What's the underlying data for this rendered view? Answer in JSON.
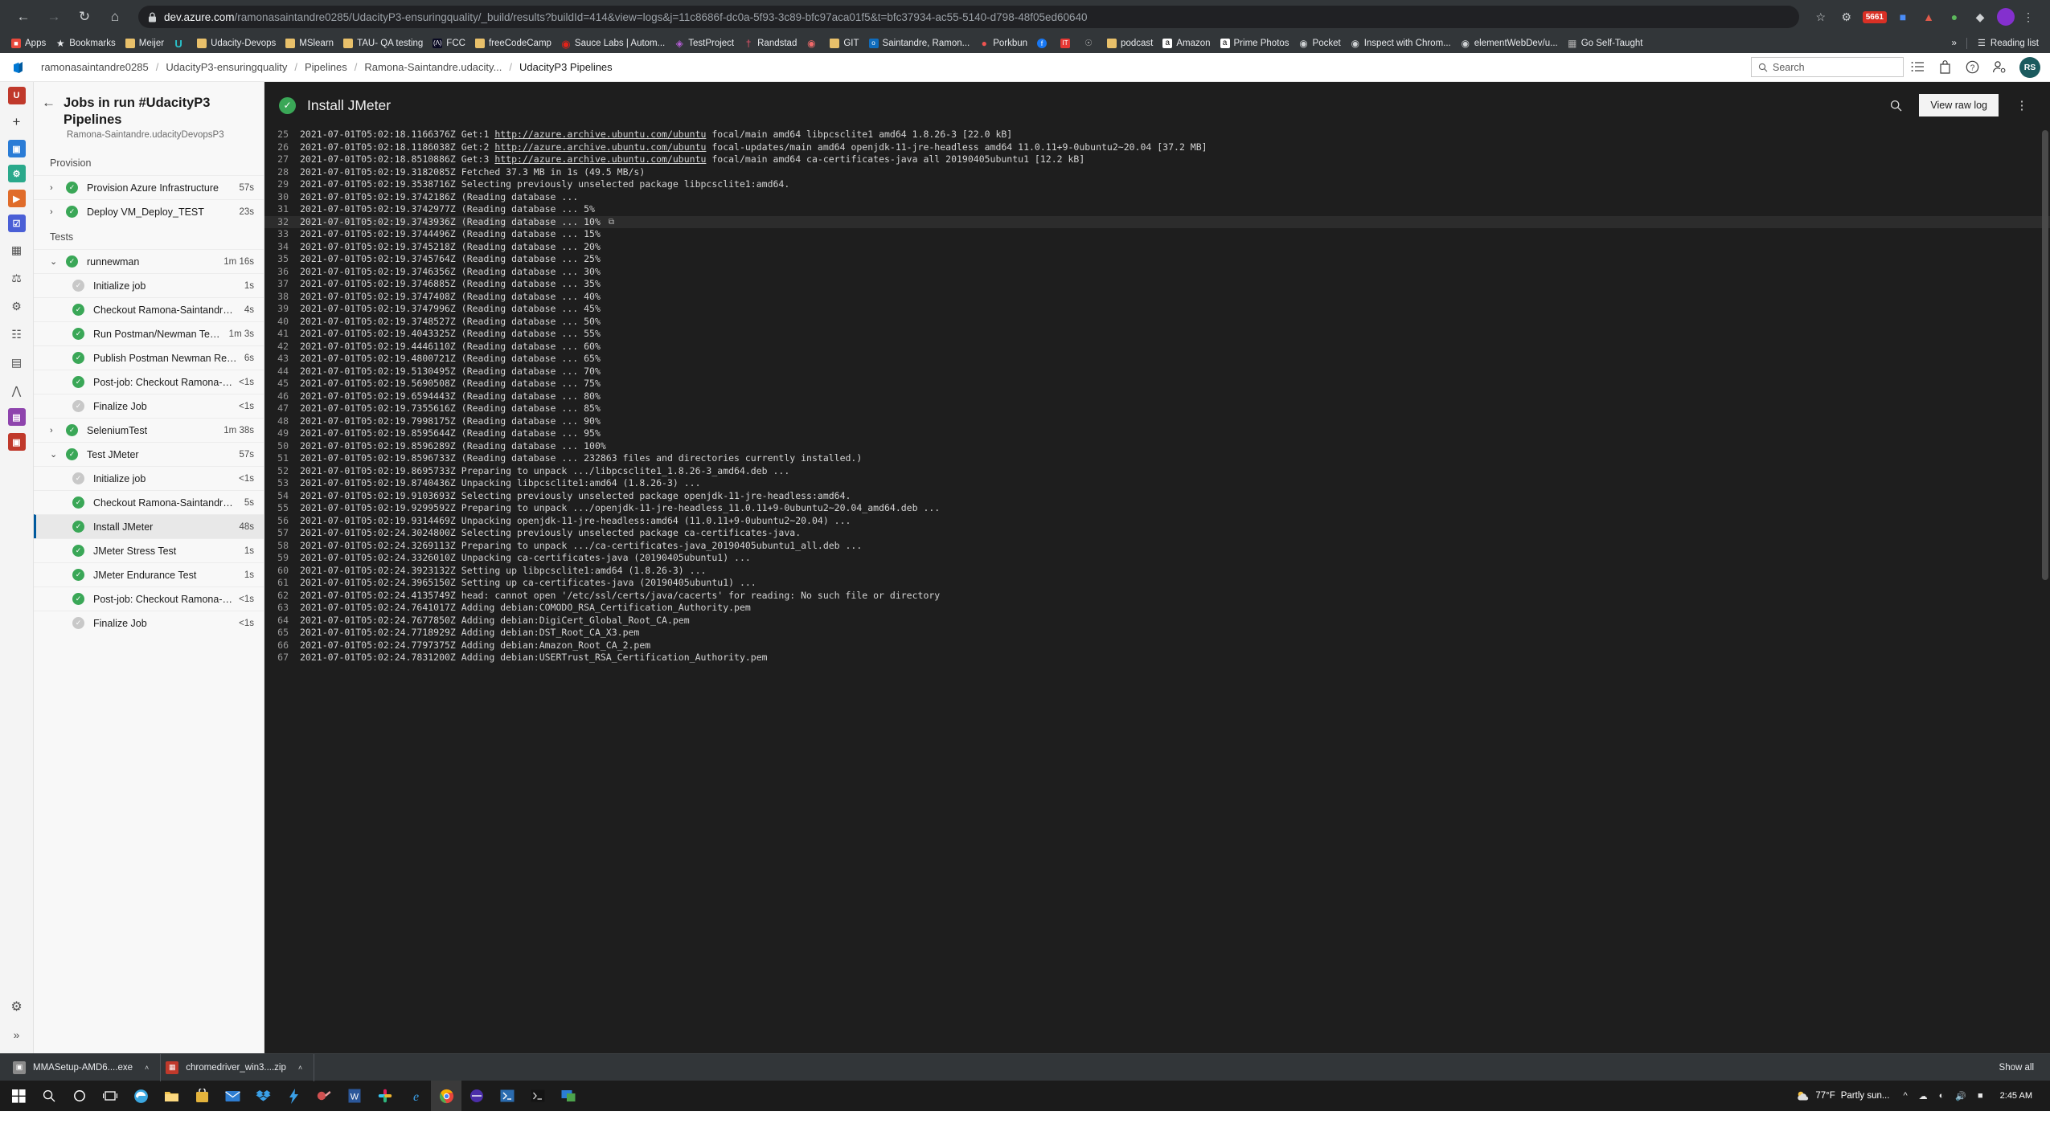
{
  "browser": {
    "url_host": "dev.azure.com",
    "url_path": "/ramonasaintandre0285/UdacityP3-ensuringquality/_build/results?buildId=414&view=logs&j=11c8686f-dc0a-5f93-3c89-bfc97aca01f5&t=bfc37934-ac55-5140-d798-48f05ed60640",
    "back_icon": "back-arrow",
    "forward_icon": "forward-arrow",
    "reload_icon": "reload",
    "home_icon": "home",
    "lock_icon": "lock",
    "extension_badge": "5661",
    "profile_initial": "",
    "bookmarks": [
      {
        "label": "Apps",
        "icon": "apps-grid",
        "color": "#4a8cf7"
      },
      {
        "label": "Bookmarks",
        "icon": "star",
        "color": "#dcdcdc"
      },
      {
        "label": "Meijer",
        "icon": "folder",
        "color": "#e8c06a"
      },
      {
        "label": "",
        "icon": "udemy-u",
        "color": "#29c3cc"
      },
      {
        "label": "Udacity-Devops",
        "icon": "folder",
        "color": "#e8c06a"
      },
      {
        "label": "MSlearn",
        "icon": "folder",
        "color": "#e8c06a"
      },
      {
        "label": "TAU- QA testing",
        "icon": "folder",
        "color": "#e8c06a"
      },
      {
        "label": "FCC",
        "icon": "fcc-badge",
        "color": "#0a0a23"
      },
      {
        "label": "freeCodeCamp",
        "icon": "folder",
        "color": "#e8c06a"
      },
      {
        "label": "Sauce Labs | Autom...",
        "icon": "sauce-labs",
        "color": "#e2231a"
      },
      {
        "label": "TestProject",
        "icon": "testproject",
        "color": "#b45dd6"
      },
      {
        "label": "Randstad",
        "icon": "randstad",
        "color": "#e8546b"
      },
      {
        "label": "",
        "icon": "asana-dots",
        "color": "#f06a6a"
      },
      {
        "label": "GIT",
        "icon": "folder",
        "color": "#e8c06a"
      },
      {
        "label": "Saintandre, Ramon...",
        "icon": "outlook",
        "color": "#0f6cbd"
      },
      {
        "label": "Porkbun",
        "icon": "porkbun",
        "color": "#ef5350"
      },
      {
        "label": "",
        "icon": "facebook",
        "color": "#1877f2"
      },
      {
        "label": "",
        "icon": "it-ticket",
        "color": "#e53935"
      },
      {
        "label": "",
        "icon": "cb-coin",
        "color": "#b0b0b0"
      },
      {
        "label": "podcast",
        "icon": "folder",
        "color": "#e8c06a"
      },
      {
        "label": "Amazon",
        "icon": "amazon",
        "color": "#ffffff"
      },
      {
        "label": "Prime Photos",
        "icon": "amazon",
        "color": "#ffffff"
      },
      {
        "label": "Pocket",
        "icon": "pocket",
        "color": "#ef4056"
      },
      {
        "label": "Inspect with Chrom...",
        "icon": "pocket",
        "color": "#9aa0a6"
      },
      {
        "label": "elementWebDev/u...",
        "icon": "pocket",
        "color": "#9aa0a6"
      },
      {
        "label": "Go Self-Taught",
        "icon": "cube",
        "color": "#b0b0b0"
      }
    ],
    "overflow_label": "»",
    "reading_list_label": "Reading list",
    "reading_list_icon": "reading-list-icon"
  },
  "ado_header": {
    "logo_icon": "azure-devops-logo",
    "breadcrumb": [
      "ramonasaintandre0285",
      "UdacityP3-ensuringquality",
      "Pipelines",
      "Ramona-Saintandre.udacity...",
      "UdacityP3 Pipelines"
    ],
    "search_placeholder": "Search",
    "search_icon": "search-icon",
    "icons": [
      {
        "name": "boards-list-icon"
      },
      {
        "name": "marketplace-bag-icon"
      },
      {
        "name": "help-question-icon"
      },
      {
        "name": "user-settings-icon"
      }
    ],
    "avatar_initials": "RS",
    "avatar_color": "#1b5a5e"
  },
  "rail": {
    "items": [
      {
        "name": "overview-badge",
        "glyph": "U",
        "color": "#c0392b"
      },
      {
        "name": "new-item-icon",
        "glyph": "＋",
        "color": ""
      },
      {
        "name": "boards-icon",
        "glyph": "",
        "color": "#2a7cd6"
      },
      {
        "name": "repos-icon",
        "glyph": "",
        "color": "#2aa98b"
      },
      {
        "name": "pipelines-icon",
        "glyph": "",
        "color": "#e06c2a"
      },
      {
        "name": "test-plans-icon",
        "glyph": "",
        "color": "#4a5fd6"
      },
      {
        "name": "artifacts-icon",
        "glyph": "",
        "color": "#3b3b3b"
      },
      {
        "name": "environments-icon",
        "glyph": "",
        "color": "#3b3b3b"
      },
      {
        "name": "releases-icon",
        "glyph": "",
        "color": "#3b3b3b"
      },
      {
        "name": "library-icon",
        "glyph": "",
        "color": "#3b3b3b"
      },
      {
        "name": "task-groups-icon",
        "glyph": "",
        "color": "#3b3b3b"
      },
      {
        "name": "deployment-groups-icon",
        "glyph": "",
        "color": "#3b3b3b"
      },
      {
        "name": "analytics-icon",
        "glyph": "",
        "color": "#8e44ad"
      },
      {
        "name": "extensions-icon",
        "glyph": "",
        "color": "#c0392b"
      }
    ],
    "settings_icon": "settings-gear-icon",
    "expand_icon": "expand-chevrons-icon"
  },
  "jobs_panel": {
    "back_icon": "back-arrow-icon",
    "title": "Jobs in run #UdacityP3 Pipelines",
    "subtitle": "Ramona-Saintandre.udacityDevopsP3",
    "groups": [
      {
        "label": "Provision",
        "jobs": [
          {
            "name": "Provision Azure Infrastructure",
            "duration": "57s",
            "status": "ok",
            "expander": "collapsed",
            "level": "top",
            "selected": false
          },
          {
            "name": "Deploy VM_Deploy_TEST",
            "duration": "23s",
            "status": "ok",
            "expander": "collapsed",
            "level": "top",
            "selected": false
          }
        ]
      },
      {
        "label": "Tests",
        "jobs": [
          {
            "name": "runnewman",
            "duration": "1m 16s",
            "status": "ok",
            "expander": "expanded",
            "level": "top",
            "selected": false
          },
          {
            "name": "Initialize job",
            "duration": "1s",
            "status": "skip",
            "expander": "none",
            "level": "child",
            "selected": false
          },
          {
            "name": "Checkout Ramona-Saintandre/ud...",
            "duration": "4s",
            "status": "ok",
            "expander": "none",
            "level": "child",
            "selected": false
          },
          {
            "name": "Run Postman/Newman Tests",
            "duration": "1m 3s",
            "status": "ok",
            "expander": "none",
            "level": "child",
            "selected": false
          },
          {
            "name": "Publish Postman Newman Results...",
            "duration": "6s",
            "status": "ok",
            "expander": "none",
            "level": "child",
            "selected": false
          },
          {
            "name": "Post-job: Checkout Ramona-Sai...",
            "duration": "<1s",
            "status": "ok",
            "expander": "none",
            "level": "child",
            "selected": false
          },
          {
            "name": "Finalize Job",
            "duration": "<1s",
            "status": "skip",
            "expander": "none",
            "level": "child",
            "selected": false
          },
          {
            "name": "SeleniumTest",
            "duration": "1m 38s",
            "status": "ok",
            "expander": "collapsed",
            "level": "top",
            "selected": false
          },
          {
            "name": "Test JMeter",
            "duration": "57s",
            "status": "ok",
            "expander": "expanded",
            "level": "top",
            "selected": false
          },
          {
            "name": "Initialize job",
            "duration": "<1s",
            "status": "skip",
            "expander": "none",
            "level": "child",
            "selected": false
          },
          {
            "name": "Checkout Ramona-Saintandre/ud...",
            "duration": "5s",
            "status": "ok",
            "expander": "none",
            "level": "child",
            "selected": false
          },
          {
            "name": "Install JMeter",
            "duration": "48s",
            "status": "ok",
            "expander": "none",
            "level": "child",
            "selected": true
          },
          {
            "name": "JMeter Stress Test",
            "duration": "1s",
            "status": "ok",
            "expander": "none",
            "level": "child",
            "selected": false
          },
          {
            "name": "JMeter Endurance Test",
            "duration": "1s",
            "status": "ok",
            "expander": "none",
            "level": "child",
            "selected": false
          },
          {
            "name": "Post-job: Checkout Ramona-Sai...",
            "duration": "<1s",
            "status": "ok",
            "expander": "none",
            "level": "child",
            "selected": false
          },
          {
            "name": "Finalize Job",
            "duration": "<1s",
            "status": "skip",
            "expander": "none",
            "level": "child",
            "selected": false
          }
        ]
      }
    ]
  },
  "log": {
    "step_status": "ok",
    "step_title": "Install JMeter",
    "search_icon": "search-log-icon",
    "view_raw_log_label": "View raw log",
    "more_icon": "more-actions-icon",
    "highlight_line": 32,
    "copy_icon": "copy-icon",
    "lines": [
      {
        "n": 25,
        "pre": "2021-07-01T05:02:18.1166376Z Get:1 ",
        "link": "http://azure.archive.ubuntu.com/ubuntu",
        "post": " focal/main amd64 libpcsclite1 amd64 1.8.26-3 [22.0 kB]"
      },
      {
        "n": 26,
        "pre": "2021-07-01T05:02:18.1186038Z Get:2 ",
        "link": "http://azure.archive.ubuntu.com/ubuntu",
        "post": " focal-updates/main amd64 openjdk-11-jre-headless amd64 11.0.11+9-0ubuntu2~20.04 [37.2 MB]"
      },
      {
        "n": 27,
        "pre": "2021-07-01T05:02:18.8510886Z Get:3 ",
        "link": "http://azure.archive.ubuntu.com/ubuntu",
        "post": " focal/main amd64 ca-certificates-java all 20190405ubuntu1 [12.2 kB]"
      },
      {
        "n": 28,
        "pre": "2021-07-01T05:02:19.3182085Z Fetched 37.3 MB in 1s (49.5 MB/s)",
        "link": "",
        "post": ""
      },
      {
        "n": 29,
        "pre": "2021-07-01T05:02:19.3538716Z Selecting previously unselected package libpcsclite1:amd64.",
        "link": "",
        "post": ""
      },
      {
        "n": 30,
        "pre": "2021-07-01T05:02:19.3742186Z (Reading database ...",
        "link": "",
        "post": ""
      },
      {
        "n": 31,
        "pre": "2021-07-01T05:02:19.3742977Z (Reading database ... 5%",
        "link": "",
        "post": ""
      },
      {
        "n": 32,
        "pre": "2021-07-01T05:02:19.3743936Z (Reading database ... 10%",
        "link": "",
        "post": ""
      },
      {
        "n": 33,
        "pre": "2021-07-01T05:02:19.3744496Z (Reading database ... 15%",
        "link": "",
        "post": ""
      },
      {
        "n": 34,
        "pre": "2021-07-01T05:02:19.3745218Z (Reading database ... 20%",
        "link": "",
        "post": ""
      },
      {
        "n": 35,
        "pre": "2021-07-01T05:02:19.3745764Z (Reading database ... 25%",
        "link": "",
        "post": ""
      },
      {
        "n": 36,
        "pre": "2021-07-01T05:02:19.3746356Z (Reading database ... 30%",
        "link": "",
        "post": ""
      },
      {
        "n": 37,
        "pre": "2021-07-01T05:02:19.3746885Z (Reading database ... 35%",
        "link": "",
        "post": ""
      },
      {
        "n": 38,
        "pre": "2021-07-01T05:02:19.3747408Z (Reading database ... 40%",
        "link": "",
        "post": ""
      },
      {
        "n": 39,
        "pre": "2021-07-01T05:02:19.3747996Z (Reading database ... 45%",
        "link": "",
        "post": ""
      },
      {
        "n": 40,
        "pre": "2021-07-01T05:02:19.3748527Z (Reading database ... 50%",
        "link": "",
        "post": ""
      },
      {
        "n": 41,
        "pre": "2021-07-01T05:02:19.4043325Z (Reading database ... 55%",
        "link": "",
        "post": ""
      },
      {
        "n": 42,
        "pre": "2021-07-01T05:02:19.4446110Z (Reading database ... 60%",
        "link": "",
        "post": ""
      },
      {
        "n": 43,
        "pre": "2021-07-01T05:02:19.4800721Z (Reading database ... 65%",
        "link": "",
        "post": ""
      },
      {
        "n": 44,
        "pre": "2021-07-01T05:02:19.5130495Z (Reading database ... 70%",
        "link": "",
        "post": ""
      },
      {
        "n": 45,
        "pre": "2021-07-01T05:02:19.5690508Z (Reading database ... 75%",
        "link": "",
        "post": ""
      },
      {
        "n": 46,
        "pre": "2021-07-01T05:02:19.6594443Z (Reading database ... 80%",
        "link": "",
        "post": ""
      },
      {
        "n": 47,
        "pre": "2021-07-01T05:02:19.7355616Z (Reading database ... 85%",
        "link": "",
        "post": ""
      },
      {
        "n": 48,
        "pre": "2021-07-01T05:02:19.7998175Z (Reading database ... 90%",
        "link": "",
        "post": ""
      },
      {
        "n": 49,
        "pre": "2021-07-01T05:02:19.8595644Z (Reading database ... 95%",
        "link": "",
        "post": ""
      },
      {
        "n": 50,
        "pre": "2021-07-01T05:02:19.8596289Z (Reading database ... 100%",
        "link": "",
        "post": ""
      },
      {
        "n": 51,
        "pre": "2021-07-01T05:02:19.8596733Z (Reading database ... 232863 files and directories currently installed.)",
        "link": "",
        "post": ""
      },
      {
        "n": 52,
        "pre": "2021-07-01T05:02:19.8695733Z Preparing to unpack .../libpcsclite1_1.8.26-3_amd64.deb ...",
        "link": "",
        "post": ""
      },
      {
        "n": 53,
        "pre": "2021-07-01T05:02:19.8740436Z Unpacking libpcsclite1:amd64 (1.8.26-3) ...",
        "link": "",
        "post": ""
      },
      {
        "n": 54,
        "pre": "2021-07-01T05:02:19.9103693Z Selecting previously unselected package openjdk-11-jre-headless:amd64.",
        "link": "",
        "post": ""
      },
      {
        "n": 55,
        "pre": "2021-07-01T05:02:19.9299592Z Preparing to unpack .../openjdk-11-jre-headless_11.0.11+9-0ubuntu2~20.04_amd64.deb ...",
        "link": "",
        "post": ""
      },
      {
        "n": 56,
        "pre": "2021-07-01T05:02:19.9314469Z Unpacking openjdk-11-jre-headless:amd64 (11.0.11+9-0ubuntu2~20.04) ...",
        "link": "",
        "post": ""
      },
      {
        "n": 57,
        "pre": "2021-07-01T05:02:24.3024800Z Selecting previously unselected package ca-certificates-java.",
        "link": "",
        "post": ""
      },
      {
        "n": 58,
        "pre": "2021-07-01T05:02:24.3269113Z Preparing to unpack .../ca-certificates-java_20190405ubuntu1_all.deb ...",
        "link": "",
        "post": ""
      },
      {
        "n": 59,
        "pre": "2021-07-01T05:02:24.3326010Z Unpacking ca-certificates-java (20190405ubuntu1) ...",
        "link": "",
        "post": ""
      },
      {
        "n": 60,
        "pre": "2021-07-01T05:02:24.3923132Z Setting up libpcsclite1:amd64 (1.8.26-3) ...",
        "link": "",
        "post": ""
      },
      {
        "n": 61,
        "pre": "2021-07-01T05:02:24.3965150Z Setting up ca-certificates-java (20190405ubuntu1) ...",
        "link": "",
        "post": ""
      },
      {
        "n": 62,
        "pre": "2021-07-01T05:02:24.4135749Z head: cannot open '/etc/ssl/certs/java/cacerts' for reading: No such file or directory",
        "link": "",
        "post": ""
      },
      {
        "n": 63,
        "pre": "2021-07-01T05:02:24.7641017Z Adding debian:COMODO_RSA_Certification_Authority.pem",
        "link": "",
        "post": ""
      },
      {
        "n": 64,
        "pre": "2021-07-01T05:02:24.7677850Z Adding debian:DigiCert_Global_Root_CA.pem",
        "link": "",
        "post": ""
      },
      {
        "n": 65,
        "pre": "2021-07-01T05:02:24.7718929Z Adding debian:DST_Root_CA_X3.pem",
        "link": "",
        "post": ""
      },
      {
        "n": 66,
        "pre": "2021-07-01T05:02:24.7797375Z Adding debian:Amazon_Root_CA_2.pem",
        "link": "",
        "post": ""
      },
      {
        "n": 67,
        "pre": "2021-07-01T05:02:24.7831200Z Adding debian:USERTrust_RSA_Certification_Authority.pem",
        "link": "",
        "post": ""
      }
    ]
  },
  "downloads": {
    "items": [
      {
        "label": "MMASetup-AMD6....exe",
        "icon": "installer-file-icon",
        "color": "#7a7a7a"
      },
      {
        "label": "chromedriver_win3....zip",
        "icon": "zip-file-icon",
        "color": "#c0392b"
      }
    ],
    "caret": "˄",
    "show_all_label": "Show all"
  },
  "taskbar": {
    "start_icon": "windows-start-icon",
    "icons": [
      {
        "name": "search-icon",
        "color": "#ffffff"
      },
      {
        "name": "cortana-icon",
        "color": "#ffffff"
      },
      {
        "name": "task-view-icon",
        "color": "#ffffff"
      },
      {
        "name": "edge-icon",
        "color": "#3ba7e0"
      },
      {
        "name": "file-explorer-icon",
        "color": "#f0c24a"
      },
      {
        "name": "microsoft-store-icon",
        "color": "#d8a93a"
      },
      {
        "name": "mail-icon",
        "color": "#2e7dd1"
      },
      {
        "name": "dropbox-icon",
        "color": "#3aa0e8"
      },
      {
        "name": "lightning-icon",
        "color": "#3aa0e8"
      },
      {
        "name": "paint-icon",
        "color": "#d05050"
      },
      {
        "name": "word-icon",
        "color": "#2b579a"
      },
      {
        "name": "slack-icon",
        "color": "#4ab58e"
      },
      {
        "name": "internet-explorer-icon",
        "color": "#3aa0e8"
      },
      {
        "name": "chrome-icon",
        "color": "#e8453c"
      },
      {
        "name": "postman-icon",
        "color": "#4b2ea8"
      },
      {
        "name": "powershell-icon",
        "color": "#2b6cb0"
      },
      {
        "name": "terminal-icon",
        "color": "#1b1b1b"
      },
      {
        "name": "remote-desktop-icon",
        "color": "#2b7dd6"
      }
    ],
    "weather_temp": "77°F",
    "weather_desc": "Partly sun...",
    "tray_icons": [
      {
        "name": "show-hidden-icons-caret"
      },
      {
        "name": "onedrive-icon"
      },
      {
        "name": "network-icon"
      },
      {
        "name": "volume-icon"
      },
      {
        "name": "battery-icon"
      }
    ],
    "time": "2:45 AM",
    "date": ""
  }
}
